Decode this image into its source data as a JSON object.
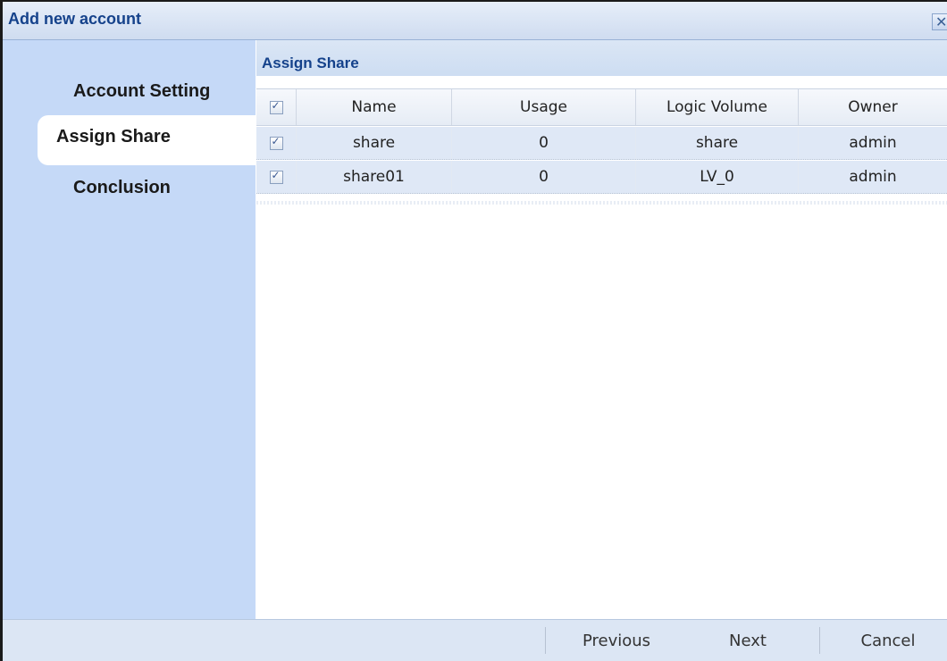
{
  "dialog": {
    "title": "Add new account",
    "close_glyph": "✕"
  },
  "nav": {
    "items": [
      {
        "label": "Account Setting",
        "active": false
      },
      {
        "label": "Assign Share",
        "active": true
      },
      {
        "label": "Conclusion",
        "active": false
      }
    ]
  },
  "panel": {
    "title": "Assign Share"
  },
  "grid": {
    "columns": [
      "Name",
      "Usage",
      "Logic Volume",
      "Owner"
    ],
    "header_checked": true,
    "rows": [
      {
        "checked": true,
        "name": "share",
        "usage": "0",
        "volume": "share",
        "owner": "admin"
      },
      {
        "checked": true,
        "name": "share01",
        "usage": "0",
        "volume": "LV_0",
        "owner": "admin"
      }
    ]
  },
  "footer": {
    "previous_label": "Previous",
    "next_label": "Next",
    "cancel_label": "Cancel"
  },
  "colors": {
    "title_text": "#15428b",
    "nav_bg": "#c5d9f7",
    "row_bg": "#dfe8f6",
    "footer_bg": "#dce6f4"
  }
}
